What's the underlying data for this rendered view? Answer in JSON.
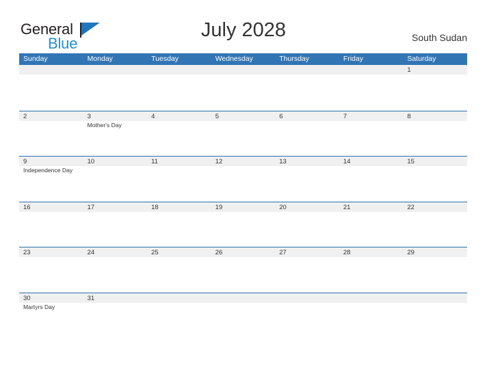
{
  "brand": {
    "word_one": "General",
    "word_two": "Blue",
    "primary_color": "#1f76bc",
    "secondary_color": "#1f8fd6"
  },
  "header": {
    "title": "July 2028",
    "region": "South Sudan"
  },
  "calendar": {
    "header_bg": "#3275b5",
    "band_bg": "#f0f0f0",
    "rule_color": "#2e6fab",
    "weekdays": [
      "Sunday",
      "Monday",
      "Tuesday",
      "Wednesday",
      "Thursday",
      "Friday",
      "Saturday"
    ],
    "weeks": [
      [
        {
          "num": "",
          "events": []
        },
        {
          "num": "",
          "events": []
        },
        {
          "num": "",
          "events": []
        },
        {
          "num": "",
          "events": []
        },
        {
          "num": "",
          "events": []
        },
        {
          "num": "",
          "events": []
        },
        {
          "num": "1",
          "events": []
        }
      ],
      [
        {
          "num": "2",
          "events": []
        },
        {
          "num": "3",
          "events": [
            "Mother's Day"
          ]
        },
        {
          "num": "4",
          "events": []
        },
        {
          "num": "5",
          "events": []
        },
        {
          "num": "6",
          "events": []
        },
        {
          "num": "7",
          "events": []
        },
        {
          "num": "8",
          "events": []
        }
      ],
      [
        {
          "num": "9",
          "events": [
            "Independence Day"
          ]
        },
        {
          "num": "10",
          "events": []
        },
        {
          "num": "11",
          "events": []
        },
        {
          "num": "12",
          "events": []
        },
        {
          "num": "13",
          "events": []
        },
        {
          "num": "14",
          "events": []
        },
        {
          "num": "15",
          "events": []
        }
      ],
      [
        {
          "num": "16",
          "events": []
        },
        {
          "num": "17",
          "events": []
        },
        {
          "num": "18",
          "events": []
        },
        {
          "num": "19",
          "events": []
        },
        {
          "num": "20",
          "events": []
        },
        {
          "num": "21",
          "events": []
        },
        {
          "num": "22",
          "events": []
        }
      ],
      [
        {
          "num": "23",
          "events": []
        },
        {
          "num": "24",
          "events": []
        },
        {
          "num": "25",
          "events": []
        },
        {
          "num": "26",
          "events": []
        },
        {
          "num": "27",
          "events": []
        },
        {
          "num": "28",
          "events": []
        },
        {
          "num": "29",
          "events": []
        }
      ],
      [
        {
          "num": "30",
          "events": [
            "Martyrs Day"
          ]
        },
        {
          "num": "31",
          "events": []
        },
        {
          "num": "",
          "events": []
        },
        {
          "num": "",
          "events": []
        },
        {
          "num": "",
          "events": []
        },
        {
          "num": "",
          "events": []
        },
        {
          "num": "",
          "events": []
        }
      ]
    ]
  }
}
